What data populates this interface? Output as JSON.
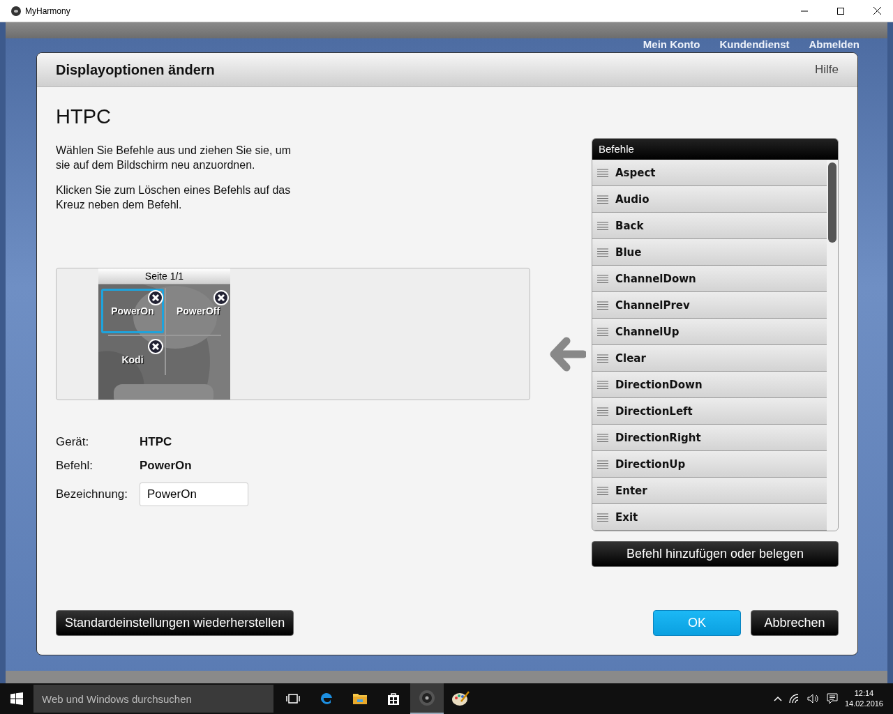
{
  "window": {
    "title": "MyHarmony"
  },
  "nav": [
    "Mein Konto",
    "Kundendienst",
    "Abmelden"
  ],
  "dialog": {
    "title": "Displayoptionen ändern",
    "help": "Hilfe",
    "device": "HTPC",
    "instructions": [
      "Wählen Sie Befehle aus und ziehen Sie sie, um sie auf dem Bildschirm neu anzuordnen.",
      "Klicken Sie zum Löschen eines Befehls auf das Kreuz neben dem Befehl."
    ],
    "preview": {
      "page_label": "Seite 1/1",
      "buttons": [
        {
          "label": "PowerOn",
          "selected": true
        },
        {
          "label": "PowerOff",
          "selected": false
        },
        {
          "label": "Kodi",
          "selected": false
        }
      ]
    },
    "details": [
      {
        "kind": "text",
        "label": "Gerät:",
        "value": "HTPC"
      },
      {
        "kind": "text",
        "label": "Befehl:",
        "value": "PowerOn"
      },
      {
        "kind": "field",
        "label": "Bezeichnung:",
        "value": "PowerOn"
      }
    ],
    "commands": {
      "title": "Befehle",
      "items": [
        "Aspect",
        "Audio",
        "Back",
        "Blue",
        "ChannelDown",
        "ChannelPrev",
        "ChannelUp",
        "Clear",
        "DirectionDown",
        "DirectionLeft",
        "DirectionRight",
        "DirectionUp",
        "Enter",
        "Exit"
      ]
    },
    "add_button": "Befehl hinzufügen oder belegen",
    "restore_button": "Standardeinstellungen wiederherstellen",
    "ok_button": "OK",
    "cancel_button": "Abbrechen"
  },
  "taskbar": {
    "search_placeholder": "Web und Windows durchsuchen",
    "apps": [
      {
        "kind": "taskview",
        "selected": false
      },
      {
        "kind": "edge",
        "selected": false
      },
      {
        "kind": "folder",
        "selected": false
      },
      {
        "kind": "store",
        "selected": false
      },
      {
        "kind": "harmony",
        "selected": true
      },
      {
        "kind": "paint",
        "selected": false
      }
    ],
    "time": "12:14",
    "date": "14.02.2016"
  }
}
